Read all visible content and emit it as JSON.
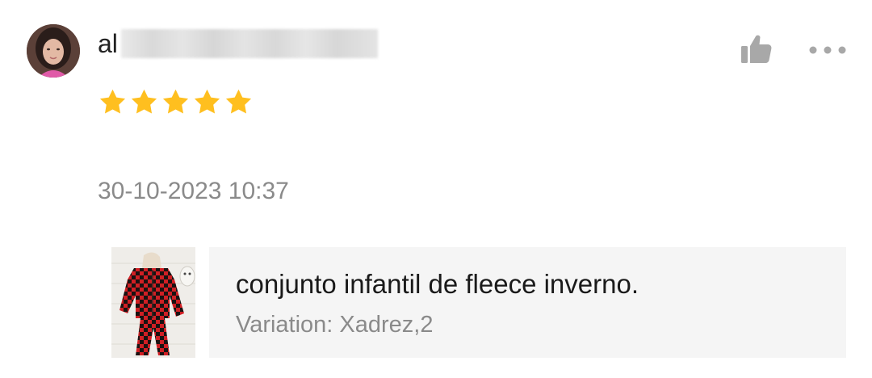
{
  "review": {
    "username_visible": "al",
    "rating": 5,
    "rating_max": 5,
    "timestamp": "30-10-2023 10:37"
  },
  "actions": {
    "like_icon": "thumbs-up-icon",
    "more_icon": "more-horizontal-icon"
  },
  "product": {
    "name": "conjunto infantil de fleece inverno.",
    "variation": "Variation: Xadrez,2"
  },
  "colors": {
    "star": "#FFBF1F",
    "icon": "#A8A8A8",
    "timestamp": "#8A8A8A",
    "product_panel_bg": "#F5F5F5"
  }
}
